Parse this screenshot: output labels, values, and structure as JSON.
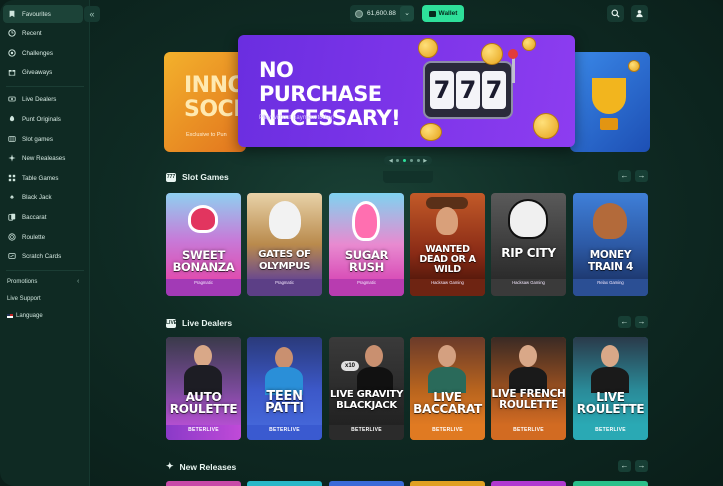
{
  "sidebar": {
    "collapse_icon": "chevron-left-icon",
    "items": [
      {
        "label": "Favourites",
        "icon": "bookmark-icon",
        "active": true
      },
      {
        "label": "Recent",
        "icon": "clock-icon"
      },
      {
        "label": "Challenges",
        "icon": "target-icon"
      },
      {
        "label": "Giveaways",
        "icon": "gift-icon"
      },
      {
        "label": "Live Dealers",
        "icon": "live-icon"
      },
      {
        "label": "Punt Originals",
        "icon": "rocket-icon"
      },
      {
        "label": "Slot games",
        "icon": "slot-icon"
      },
      {
        "label": "New Realeases",
        "icon": "sparkle-icon"
      },
      {
        "label": "Table Games",
        "icon": "grid-icon"
      },
      {
        "label": "Black Jack",
        "icon": "spade-icon"
      },
      {
        "label": "Baccarat",
        "icon": "cards-icon"
      },
      {
        "label": "Roulette",
        "icon": "roulette-icon"
      },
      {
        "label": "Scratch Cards",
        "icon": "scratch-icon"
      }
    ],
    "promotions_label": "Promotions",
    "live_support_label": "Live Support",
    "language_label": "Language"
  },
  "header": {
    "balance": "61,600.88",
    "wallet_label": "Wallet",
    "search_icon": "search-icon",
    "user_icon": "user-icon"
  },
  "banners": {
    "left_title": "INNOV SOCIA",
    "left_subtitle": "Exclusive to Pun",
    "main_headline": "NO PURCHASE NECESSARY!",
    "main_subtitle": "Play without payment today!",
    "reel_symbol": "7"
  },
  "slot_games": {
    "title": "Slot Games",
    "games": [
      {
        "name": "SWEET BONANZA",
        "provider": "Pragmatic",
        "color": "#e04db0"
      },
      {
        "name": "GATES OF OLYMPUS",
        "provider": "Pragmatic",
        "color": "#b98a4c"
      },
      {
        "name": "SUGAR RUSH",
        "provider": "Pragmatic",
        "color": "#d94fb8"
      },
      {
        "name": "WANTED DEAD OR A WILD",
        "provider": "Hacksaw Gaming",
        "color": "#b8491f"
      },
      {
        "name": "RIP CITY",
        "provider": "Hacksaw Gaming",
        "color": "#3a3a3a"
      },
      {
        "name": "MONEY TRAIN 4",
        "provider": "Relax Gaming",
        "color": "#2d5aa6"
      }
    ]
  },
  "live_dealers": {
    "title": "Live Dealers",
    "games": [
      {
        "name": "AUTO ROULETTE",
        "provider": "BETERLIVE",
        "color": "#b34fd0"
      },
      {
        "name": "TEEN PATTI",
        "provider": "BETERLIVE",
        "color": "#4466d8"
      },
      {
        "name": "LIVE GRAVITY BLACKJACK",
        "provider": "BETERLIVE",
        "color": "#2b2b2b",
        "badge": "x10"
      },
      {
        "name": "LIVE BACCARAT",
        "provider": "BETERLIVE",
        "color": "#e07a22"
      },
      {
        "name": "LIVE FRENCH ROULETTE",
        "provider": "BETERLIVE",
        "color": "#d26b22"
      },
      {
        "name": "LIVE ROULETTE",
        "provider": "BETERLIVE",
        "color": "#2aa9b4"
      }
    ]
  },
  "new_releases": {
    "title": "New Releases"
  },
  "nav_arrows": {
    "prev": "←",
    "next": "→"
  },
  "colors": {
    "accent": "#2ee09a",
    "background": "#0f2b24",
    "banner_main": "#7b34e8"
  }
}
